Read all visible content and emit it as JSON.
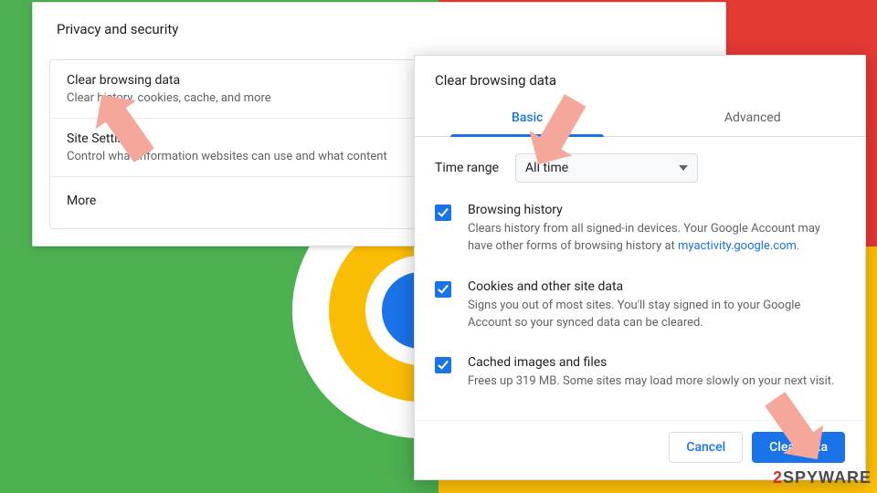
{
  "settings": {
    "section_title": "Privacy and security",
    "items": [
      {
        "title": "Clear browsing data",
        "desc": "Clear history, cookies, cache, and more"
      },
      {
        "title": "Site Settings",
        "desc": "Control what information websites can use and what content"
      },
      {
        "title": "More",
        "desc": ""
      }
    ]
  },
  "dialog": {
    "title": "Clear browsing data",
    "tabs": {
      "basic": "Basic",
      "advanced": "Advanced"
    },
    "time_range_label": "Time range",
    "time_range_value": "All time",
    "options": [
      {
        "title": "Browsing history",
        "desc_a": "Clears history from all signed-in devices. Your Google Account may have other forms of browsing history at ",
        "link": "myactivity.google.com",
        "desc_b": "."
      },
      {
        "title": "Cookies and other site data",
        "desc_a": "Signs you out of most sites. You'll stay signed in to your Google Account so your synced data can be cleared.",
        "link": "",
        "desc_b": ""
      },
      {
        "title": "Cached images and files",
        "desc_a": "Frees up 319 MB. Some sites may load more slowly on your next visit.",
        "link": "",
        "desc_b": ""
      }
    ],
    "buttons": {
      "cancel": "Cancel",
      "clear": "Clear data"
    }
  },
  "watermark": {
    "two": "2",
    "rest": "SPYWARE"
  }
}
